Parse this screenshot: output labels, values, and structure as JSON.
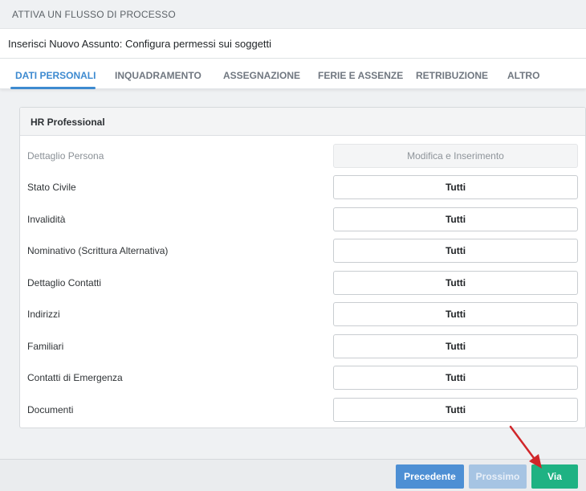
{
  "window": {
    "title": "ATTIVA UN FLUSSO DI PROCESSO"
  },
  "subheader": {
    "title": "Inserisci Nuovo Assunto: Configura permessi sui soggetti"
  },
  "tabs": [
    {
      "label": "DATI PERSONALI",
      "active": true
    },
    {
      "label": "INQUADRAMENTO",
      "active": false
    },
    {
      "label": "ASSEGNAZIONE",
      "active": false
    },
    {
      "label": "FERIE E ASSENZE",
      "active": false
    },
    {
      "label": "RETRIBUZIONE",
      "active": false
    },
    {
      "label": "ALTRO",
      "active": false
    }
  ],
  "panel": {
    "title": "HR Professional",
    "column_header": {
      "label": "Dettaglio Persona",
      "value": "Modifica e Inserimento"
    },
    "rows": [
      {
        "label": "Stato Civile",
        "value": "Tutti"
      },
      {
        "label": "Invalidità",
        "value": "Tutti"
      },
      {
        "label": "Nominativo (Scrittura Alternativa)",
        "value": "Tutti"
      },
      {
        "label": "Dettaglio Contatti",
        "value": "Tutti"
      },
      {
        "label": "Indirizzi",
        "value": "Tutti"
      },
      {
        "label": "Familiari",
        "value": "Tutti"
      },
      {
        "label": "Contatti di Emergenza",
        "value": "Tutti"
      },
      {
        "label": "Documenti",
        "value": "Tutti"
      }
    ]
  },
  "footer": {
    "prev_label": "Precedente",
    "next_label": "Prossimo",
    "go_label": "Via"
  },
  "colors": {
    "accent": "#3d8ad0",
    "primary_button": "#4d8fd4",
    "disabled_button": "#a6c4e3",
    "go_button": "#1fb283",
    "annotation_arrow": "#d0262a"
  },
  "annotation": {
    "icon": "red-arrow-icon",
    "target": "go-button"
  }
}
